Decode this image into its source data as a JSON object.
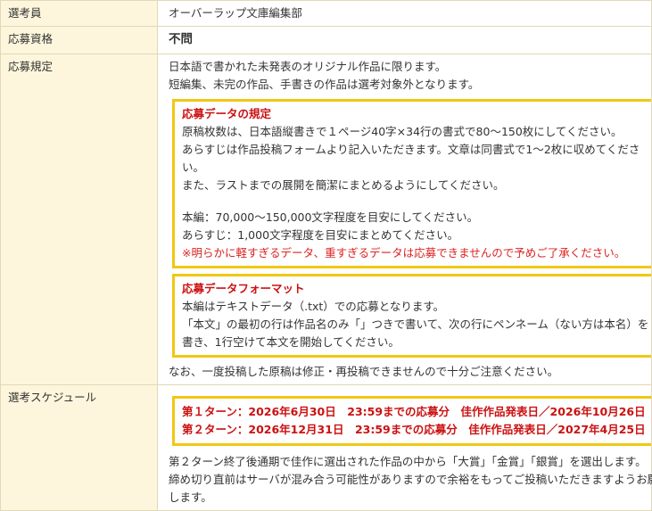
{
  "rows": {
    "judge": {
      "label": "選考員",
      "value": "オーバーラップ文庫編集部"
    },
    "eligibility": {
      "label": "応募資格",
      "value": "不問"
    },
    "rules": {
      "label": "応募規定",
      "intro": [
        "日本語で書かれた未発表のオリジナル作品に限ります。",
        "短編集、未完の作品、手書きの作品は選考対象外となります。"
      ],
      "data_box": {
        "title": "応募データの規定",
        "lines": [
          "原稿枚数は、日本語縦書きで１ページ40字×34行の書式で80〜150枚にしてください。",
          "あらすじは作品投稿フォームより記入いただきます。文章は同書式で1〜2枚に収めてくださ",
          "い。",
          "また、ラストまでの展開を簡潔にまとめるようにしてください。"
        ],
        "lines2": [
          "本編：70,000〜150,000文字程度を目安にしてください。",
          "あらすじ：1,000文字程度を目安にまとめてください。"
        ],
        "warning": "※明らかに軽すぎるデータ、重すぎるデータは応募できませんので予めご了承ください。"
      },
      "format_box": {
        "title": "応募データフォーマット",
        "lines": [
          "本編はテキストデータ（.txt）での応募となります。",
          "「本文」の最初の行は作品名のみ「」つきで書いて、次の行にペンネーム（ない方は本名）を",
          "書き、1行空けて本文を開始してください。"
        ]
      },
      "note": "なお、一度投稿した原稿は修正・再投稿できませんので十分ご注意ください。"
    },
    "schedule": {
      "label": "選考スケジュール",
      "turns": [
        "第１ターン：2026年6月30日　23:59までの応募分　佳作作品発表日／2026年10月26日",
        "第２ターン：2026年12月31日　23:59までの応募分　佳作作品発表日／2027年4月25日"
      ],
      "after": [
        "第２ターン終了後通期で佳作に選出された作品の中から「大賞」「金賞」「銀賞」を選出します。",
        "締め切り直前はサーバが混み合う可能性がありますので余裕をもってご投稿いただきますようお願い",
        "します。"
      ]
    }
  }
}
